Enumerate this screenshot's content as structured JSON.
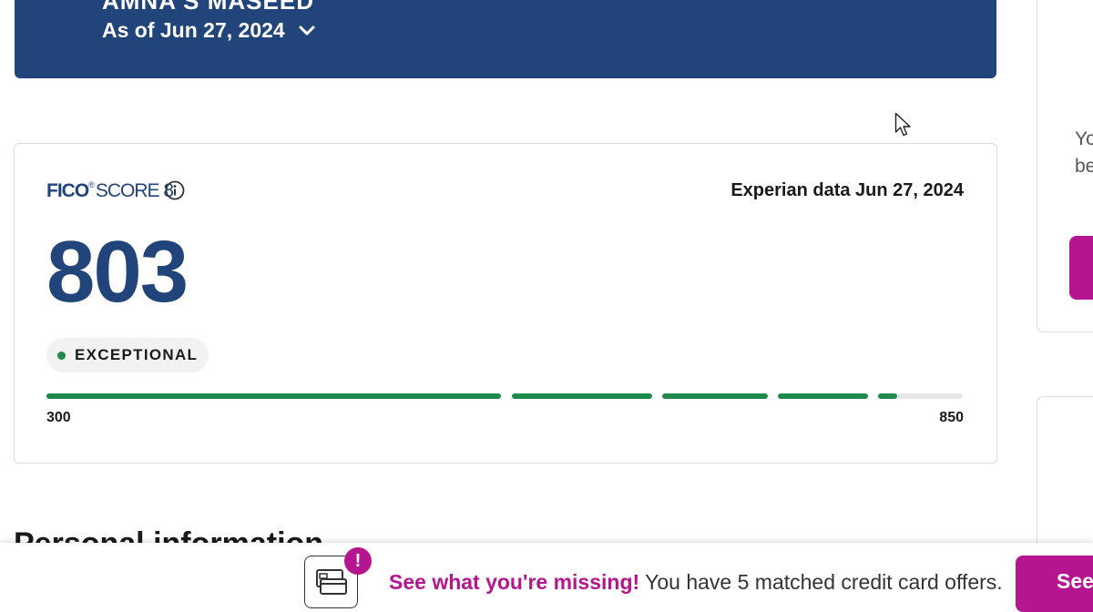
{
  "header": {
    "title": "AMNA'S MASEED",
    "as_of": "As of Jun 27, 2024"
  },
  "score_card": {
    "logo_fico": "FICO",
    "logo_reg": "®",
    "logo_score": "SCORE 8",
    "bureau_text": "Experian data Jun 27, 2024",
    "score": "803",
    "rating": "EXCEPTIONAL",
    "range_min": "300",
    "range_max": "850",
    "score_fraction_of_range": 0.915
  },
  "section": {
    "title": "Personal information"
  },
  "sidebar": {
    "text_line1": "Yo",
    "text_line2": "be"
  },
  "promo": {
    "badge": "!",
    "highlight": "See what you're missing!",
    "message": " You have 5 matched credit card offers.",
    "button_label": "See"
  },
  "colors": {
    "brand_navy": "#21457a",
    "accent_magenta": "#b5168f",
    "status_green": "#1f8a4c",
    "track_gray": "#e6e6e6"
  },
  "icons": [
    "chevron-down-icon",
    "info-icon",
    "credit-card-icon",
    "cursor-icon"
  ]
}
